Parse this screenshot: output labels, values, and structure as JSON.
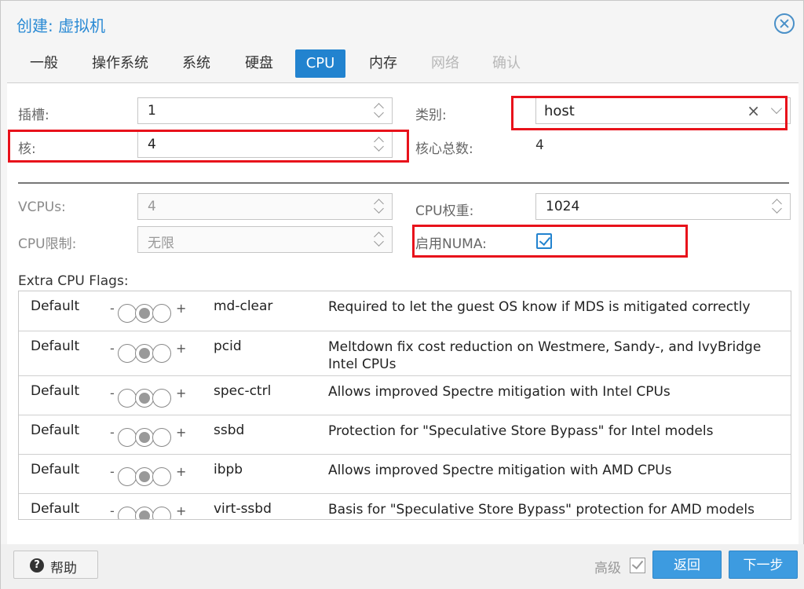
{
  "dialog": {
    "title": "创建: 虚拟机"
  },
  "tabs": [
    {
      "label": "一般",
      "state": "normal"
    },
    {
      "label": "操作系统",
      "state": "normal"
    },
    {
      "label": "系统",
      "state": "normal"
    },
    {
      "label": "硬盘",
      "state": "normal"
    },
    {
      "label": "CPU",
      "state": "active"
    },
    {
      "label": "内存",
      "state": "normal"
    },
    {
      "label": "网络",
      "state": "disabled"
    },
    {
      "label": "确认",
      "state": "disabled"
    }
  ],
  "cpu": {
    "sockets_label": "插槽:",
    "sockets_value": "1",
    "cores_label": "核:",
    "cores_value": "4",
    "type_label": "类别:",
    "type_value": "host",
    "total_cores_label": "核心总数:",
    "total_cores_value": "4",
    "vcpus_label": "VCPUs:",
    "vcpus_value": "4",
    "cpu_limit_label": "CPU限制:",
    "cpu_limit_value": "无限",
    "cpu_units_label": "CPU权重:",
    "cpu_units_value": "1024",
    "numa_label": "启用NUMA:",
    "numa_checked": true
  },
  "flags": {
    "title": "Extra CPU Flags:",
    "minus_symbol": "-",
    "plus_symbol": "+",
    "rows": [
      {
        "state": "Default",
        "name": "md-clear",
        "description": "Required to let the guest OS know if MDS is mitigated correctly"
      },
      {
        "state": "Default",
        "name": "pcid",
        "description": "Meltdown fix cost reduction on Westmere, Sandy-, and IvyBridge Intel CPUs"
      },
      {
        "state": "Default",
        "name": "spec-ctrl",
        "description": "Allows improved Spectre mitigation with Intel CPUs"
      },
      {
        "state": "Default",
        "name": "ssbd",
        "description": "Protection for \"Speculative Store Bypass\" for Intel models"
      },
      {
        "state": "Default",
        "name": "ibpb",
        "description": "Allows improved Spectre mitigation with AMD CPUs"
      },
      {
        "state": "Default",
        "name": "virt-ssbd",
        "description": "Basis for \"Speculative Store Bypass\" protection for AMD models"
      }
    ]
  },
  "footer": {
    "help_label": "帮助",
    "help_icon_glyph": "?",
    "advanced_label": "高级",
    "advanced_checked": true,
    "back_label": "返回",
    "next_label": "下一步"
  },
  "colors": {
    "accent": "#2283cf",
    "title": "#2a8ad4",
    "highlight_box": "#e8121b"
  }
}
